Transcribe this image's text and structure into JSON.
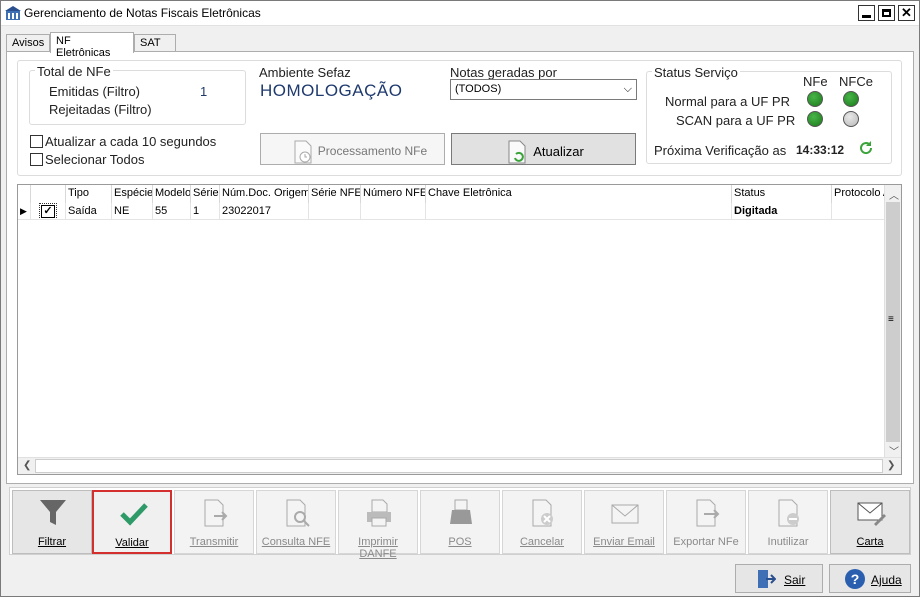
{
  "window": {
    "title": "Gerenciamento de Notas Fiscais Eletrônicas"
  },
  "tabs": [
    {
      "label": "Avisos"
    },
    {
      "label": "NF Eletrônicas"
    },
    {
      "label": "SAT"
    }
  ],
  "summary": {
    "title": "Total de NFe",
    "emitidas_label": "Emitidas (Filtro)",
    "emitidas_value": "1",
    "rejeitadas_label": "Rejeitadas (Filtro)"
  },
  "ambiente": {
    "label": "Ambiente Sefaz",
    "value": "HOMOLOGAÇÃO"
  },
  "notas_geradas": {
    "label": "Notas geradas por",
    "selected": "(TODOS)"
  },
  "status_servico": {
    "title": "Status Serviço",
    "col_nfe": "NFe",
    "col_nfce": "NFCe",
    "rows": [
      {
        "label": "Normal para a UF PR",
        "nfe": "on",
        "nfce": "on"
      },
      {
        "label": "SCAN para a UF PR",
        "nfe": "on",
        "nfce": "off"
      }
    ],
    "next_check_label": "Próxima Verificação as",
    "next_check_time": "14:33:12"
  },
  "options": {
    "auto_refresh_label": "Atualizar a cada 10 segundos",
    "select_all_label": "Selecionar Todos"
  },
  "buttons": {
    "processamento": "Processamento NFe",
    "atualizar": "Atualizar"
  },
  "grid": {
    "columns": [
      "Tipo",
      "Espécie",
      "Modelo",
      "Série",
      "Núm.Doc. Origem",
      "Série NFE",
      "Número NFE",
      "Chave Eletrônica",
      "Status",
      "Protocolo A"
    ],
    "rows": [
      {
        "checked": true,
        "cells": [
          "Saída",
          "NE",
          "55",
          "1",
          "23022017",
          "",
          "",
          "",
          "Digitada",
          ""
        ]
      }
    ]
  },
  "toolbar": [
    {
      "label": "Filtrar",
      "icon": "funnel-icon"
    },
    {
      "label": "Validar",
      "icon": "checkmark-icon"
    },
    {
      "label": "Transmitir",
      "icon": "document-send-icon"
    },
    {
      "label": "Consulta NFE",
      "icon": "document-search-icon"
    },
    {
      "label": "Imprimir DANFE",
      "icon": "printer-icon"
    },
    {
      "label": "POS",
      "icon": "pos-printer-icon"
    },
    {
      "label": "Cancelar",
      "icon": "document-cancel-icon"
    },
    {
      "label": "Enviar Email",
      "icon": "envelope-icon"
    },
    {
      "label": "Exportar NFe",
      "icon": "document-export-icon"
    },
    {
      "label": "Inutilizar",
      "icon": "document-void-icon"
    },
    {
      "label": "Carta",
      "icon": "letter-icon"
    }
  ],
  "footer": {
    "sair": "Sair",
    "ajuda": "Ajuda"
  },
  "colors": {
    "accent_focus": "#d32f2f",
    "led_green": "#1a7a1a",
    "checkmark_green": "#2e9a68",
    "ambiente_text": "#1f3a6e"
  }
}
